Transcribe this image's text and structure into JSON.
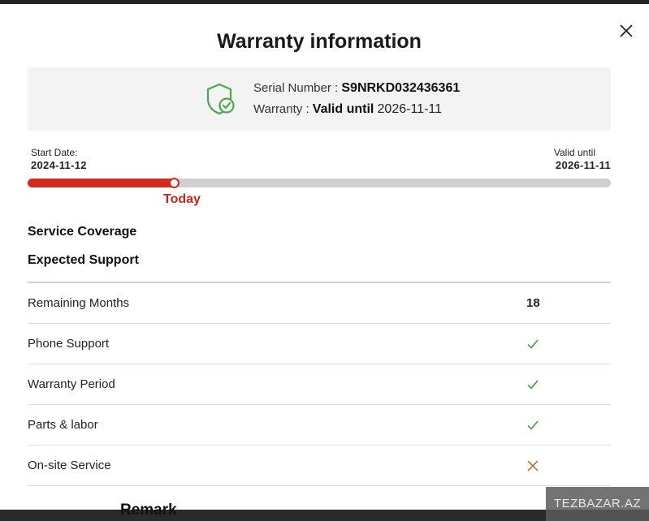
{
  "modal": {
    "title": "Warranty information",
    "serial_label": "Serial Number :",
    "serial_value": "S9NRKD032436361",
    "warranty_label": "Warranty :",
    "warranty_status": "Valid until",
    "warranty_date": "2026-11-11"
  },
  "timeline": {
    "start_label": "Start Date:",
    "start_date": "2024-11-12",
    "end_label": "Valid until",
    "end_date": "2026-11-11",
    "today_label": "Today",
    "progress_fraction": 0.25
  },
  "sections": {
    "coverage": "Service Coverage",
    "expected": "Expected Support"
  },
  "support_table": [
    {
      "label": "Remaining Months",
      "value": "18",
      "icon": null
    },
    {
      "label": "Phone Support",
      "value": null,
      "icon": "check-icon"
    },
    {
      "label": "Warranty Period",
      "value": null,
      "icon": "check-icon"
    },
    {
      "label": "Parts & labor",
      "value": null,
      "icon": "check-icon"
    },
    {
      "label": "On-site Service",
      "value": null,
      "icon": "cross-icon"
    }
  ],
  "remark": "Remark",
  "watermark": "TEZBAZAR.AZ",
  "colors": {
    "accent": "#d52b1e",
    "check": "#3a9a3a",
    "cross": "#b5651d",
    "shield": "#4aa84a"
  }
}
